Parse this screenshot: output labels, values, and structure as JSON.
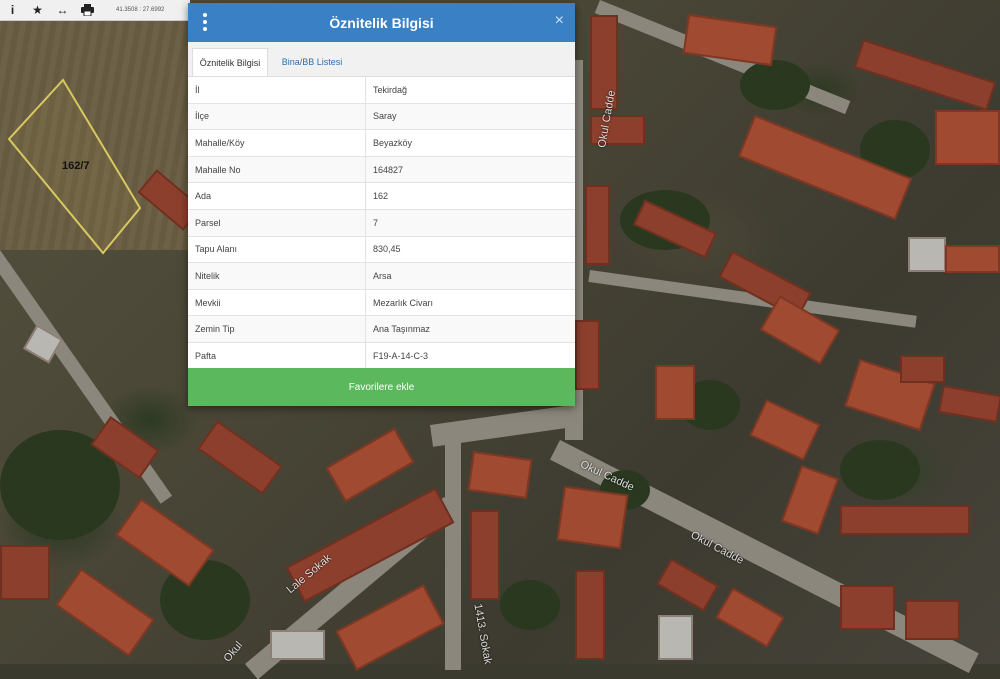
{
  "toolbar": {
    "coords": "41.3508 : 27.6992"
  },
  "map": {
    "parcel_label": "162/7",
    "streets": [
      "Okul Cadde",
      "Okul Cadde",
      "Okul Cadde",
      "Lale Sokak",
      "1413. Sokak",
      "Okul"
    ]
  },
  "popup": {
    "title": "Öznitelik Bilgisi",
    "close": "×",
    "tabs": [
      "Öznitelik Bilgisi",
      "Bina/BB Listesi"
    ],
    "rows": [
      {
        "key": "İl",
        "value": "Tekirdağ"
      },
      {
        "key": "İlçe",
        "value": "Saray"
      },
      {
        "key": "Mahalle/Köy",
        "value": "Beyazköy"
      },
      {
        "key": "Mahalle No",
        "value": "164827"
      },
      {
        "key": "Ada",
        "value": "162"
      },
      {
        "key": "Parsel",
        "value": "7"
      },
      {
        "key": "Tapu Alanı",
        "value": "830,45"
      },
      {
        "key": "Nitelik",
        "value": "Arsa"
      },
      {
        "key": "Mevkii",
        "value": "Mezarlık Civarı"
      },
      {
        "key": "Zemin Tip",
        "value": "Ana Taşınmaz"
      },
      {
        "key": "Pafta",
        "value": "F19-A-14-C-3"
      }
    ],
    "favorite_button": "Favorilere ekle"
  }
}
